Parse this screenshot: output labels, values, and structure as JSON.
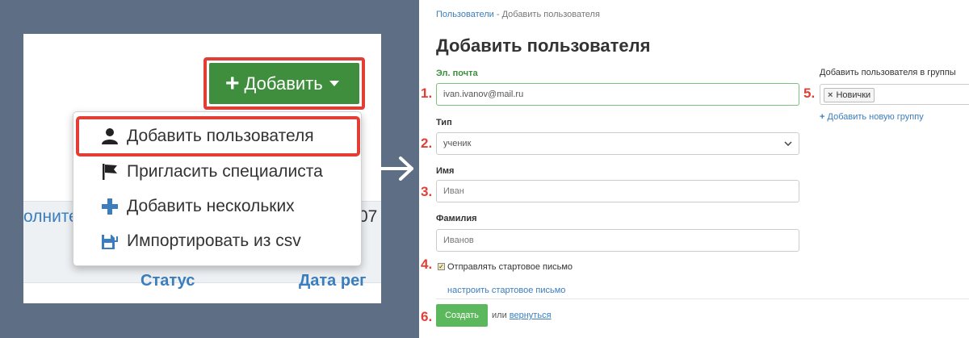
{
  "left": {
    "add_button": {
      "label": "Добавить"
    },
    "dropdown": {
      "items": [
        {
          "label": "Добавить пользователя",
          "icon": "user-icon"
        },
        {
          "label": "Пригласить специалиста",
          "icon": "flag-icon"
        },
        {
          "label": "Добавить нескольких",
          "icon": "plus-icon"
        },
        {
          "label": "Импортировать из csv",
          "icon": "import-csv-icon"
        }
      ]
    },
    "table": {
      "fragment_left": "олните",
      "fragment_right": "07",
      "col_status": "Статус",
      "col_date": "Дата рег"
    }
  },
  "right": {
    "breadcrumb": {
      "link": "Пользователи",
      "separator": " - ",
      "current": "Добавить пользователя"
    },
    "title": "Добавить пользователя",
    "form": {
      "email": {
        "label": "Эл. почта",
        "value": "ivan.ivanov@mail.ru"
      },
      "type": {
        "label": "Тип",
        "value": "ученик"
      },
      "first_name": {
        "label": "Имя",
        "placeholder": "Иван"
      },
      "last_name": {
        "label": "Фамилия",
        "placeholder": "Иванов"
      },
      "send_email": {
        "label": "Отправлять стартовое письмо",
        "checked": true
      },
      "configure_link": "настроить стартовое письмо",
      "groups": {
        "label": "Добавить пользователя в группы",
        "tag": "Новички",
        "tag_remove": "×",
        "add_group": "Добавить новую группу"
      },
      "submit": "Создать",
      "or_text": "или",
      "back_link": "вернуться"
    },
    "markers": [
      "1.",
      "2.",
      "3.",
      "4.",
      "5.",
      "6."
    ]
  },
  "colors": {
    "highlight": "#e33e36",
    "add_button_bg": "#3e8e3e",
    "create_button_bg": "#5cb85c",
    "link": "#3b7dbd",
    "background": "#5d6e85"
  }
}
